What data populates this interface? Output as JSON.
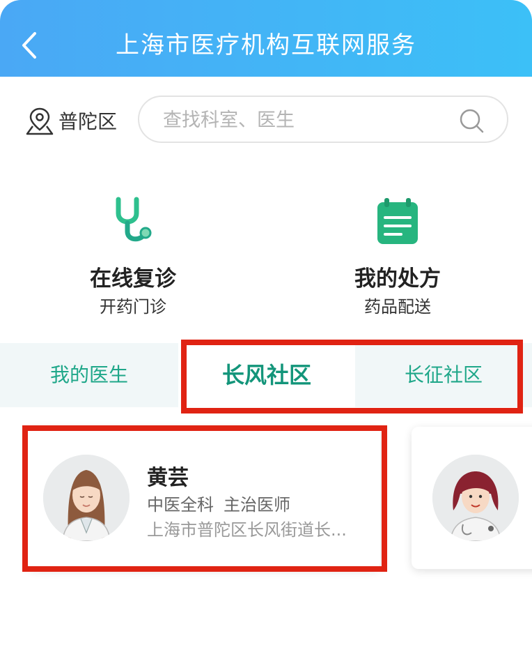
{
  "header": {
    "title": "上海市医疗机构互联网服务"
  },
  "location": {
    "district": "普陀区"
  },
  "search": {
    "placeholder": "查找科室、医生",
    "value": ""
  },
  "features": [
    {
      "title": "在线复诊",
      "subtitle": "开药门诊",
      "icon": "stethoscope-icon"
    },
    {
      "title": "我的处方",
      "subtitle": "药品配送",
      "icon": "clipboard-icon"
    }
  ],
  "tabs": [
    {
      "label": "我的医生",
      "active": false
    },
    {
      "label": "长风社区",
      "active": true
    },
    {
      "label": "长征社区",
      "active": false
    }
  ],
  "doctors": [
    {
      "name": "黄芸",
      "department": "中医全科",
      "title": "主治医师",
      "address": "上海市普陀区长风街道长..."
    }
  ],
  "colors": {
    "header_start": "#4aa8f5",
    "header_end": "#3cc0f7",
    "accent_green": "#1fa789",
    "highlight_red": "#e02313"
  }
}
